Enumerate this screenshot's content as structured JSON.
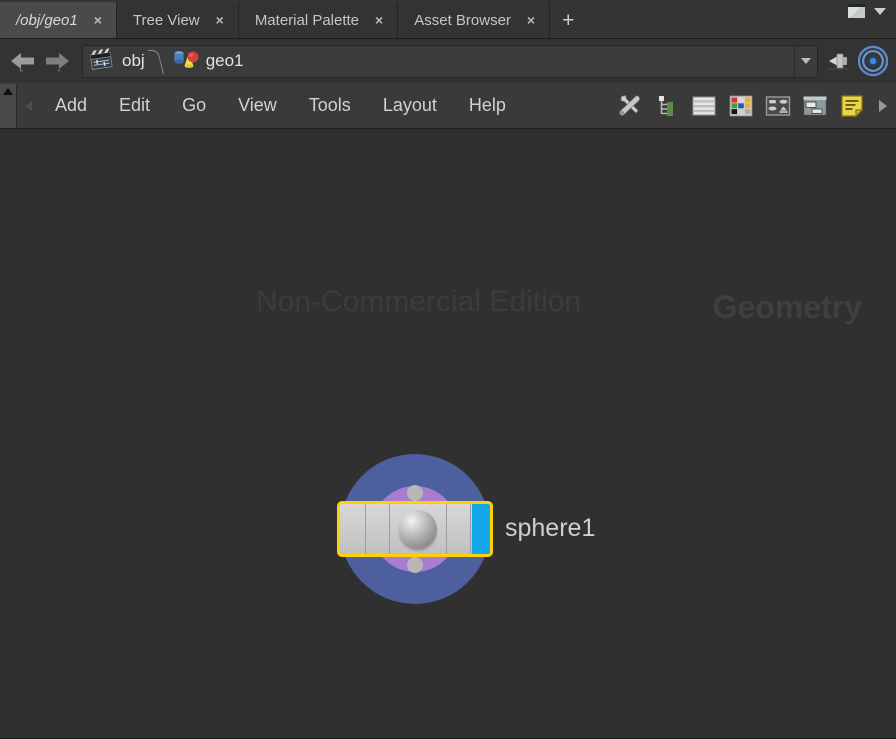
{
  "window": {
    "title": "/obj/geo1",
    "maximize_icon": "window-restore-icon",
    "menu_caret": "caret-down-icon"
  },
  "tabs": {
    "items": [
      {
        "label": "/obj/geo1",
        "active": true,
        "close": "×",
        "name": "tab-obj-geo1"
      },
      {
        "label": "Tree View",
        "active": false,
        "close": "×",
        "name": "tab-tree-view"
      },
      {
        "label": "Material Palette",
        "active": false,
        "close": "×",
        "name": "tab-material-palette"
      },
      {
        "label": "Asset Browser",
        "active": false,
        "close": "×",
        "name": "tab-asset-browser"
      }
    ],
    "add_label": "+"
  },
  "pathbar": {
    "back_icon": "arrow-left-icon",
    "forward_icon": "arrow-right-icon",
    "crumbs": [
      {
        "label": "obj",
        "icon": "clapperboard-icon"
      },
      {
        "label": "geo1",
        "icon": "geometry-object-icon"
      }
    ],
    "dropdown_icon": "chevron-down-icon",
    "pin_icon": "pin-icon",
    "target_icon": "target-icon"
  },
  "menubar": {
    "scroll_up_icon": "triangle-up-icon",
    "scroll_left_icon": "triangle-left-icon",
    "items": [
      {
        "label": "Add",
        "name": "menu-add"
      },
      {
        "label": "Edit",
        "name": "menu-edit"
      },
      {
        "label": "Go",
        "name": "menu-go"
      },
      {
        "label": "View",
        "name": "menu-view"
      },
      {
        "label": "Tools",
        "name": "menu-tools"
      },
      {
        "label": "Layout",
        "name": "menu-layout"
      },
      {
        "label": "Help",
        "name": "menu-help"
      }
    ],
    "tools": [
      {
        "icon": "wrench-screwdriver-icon",
        "name": "toolbar-tools-button"
      },
      {
        "icon": "hierarchy-tree-icon",
        "name": "toolbar-tree-button"
      },
      {
        "icon": "list-layers-icon",
        "name": "toolbar-list-button"
      },
      {
        "icon": "color-palette-grid-icon",
        "name": "toolbar-palette-button"
      },
      {
        "icon": "node-layout-icon",
        "name": "toolbar-layout-button"
      },
      {
        "icon": "panel-window-icon",
        "name": "toolbar-panel-button"
      },
      {
        "icon": "yellow-note-icon",
        "name": "toolbar-notes-button"
      }
    ],
    "more_icon": "triangle-right-icon"
  },
  "network": {
    "watermark_edition": "Non-Commercial Edition",
    "watermark_context": "Geometry",
    "nodes": [
      {
        "name": "sphere1",
        "label": "sphere1",
        "selected": true,
        "type_icon": "sphere-icon",
        "display_flag": true,
        "halo_outer_color": "#4d5f9c",
        "halo_inner_color": "#a87cd0",
        "selection_color": "#ffd100",
        "flag_color": "#12a8ea",
        "body_color": "#cdcdcd"
      }
    ]
  },
  "colors": {
    "background": "#2e2e2e",
    "network_background": "#303030",
    "tabbar": "#343434",
    "active_tab": "#4a4a4a",
    "menubar": "#3a3a3a",
    "text": "#c8c8c8",
    "watermark": "#3f3f3f"
  }
}
